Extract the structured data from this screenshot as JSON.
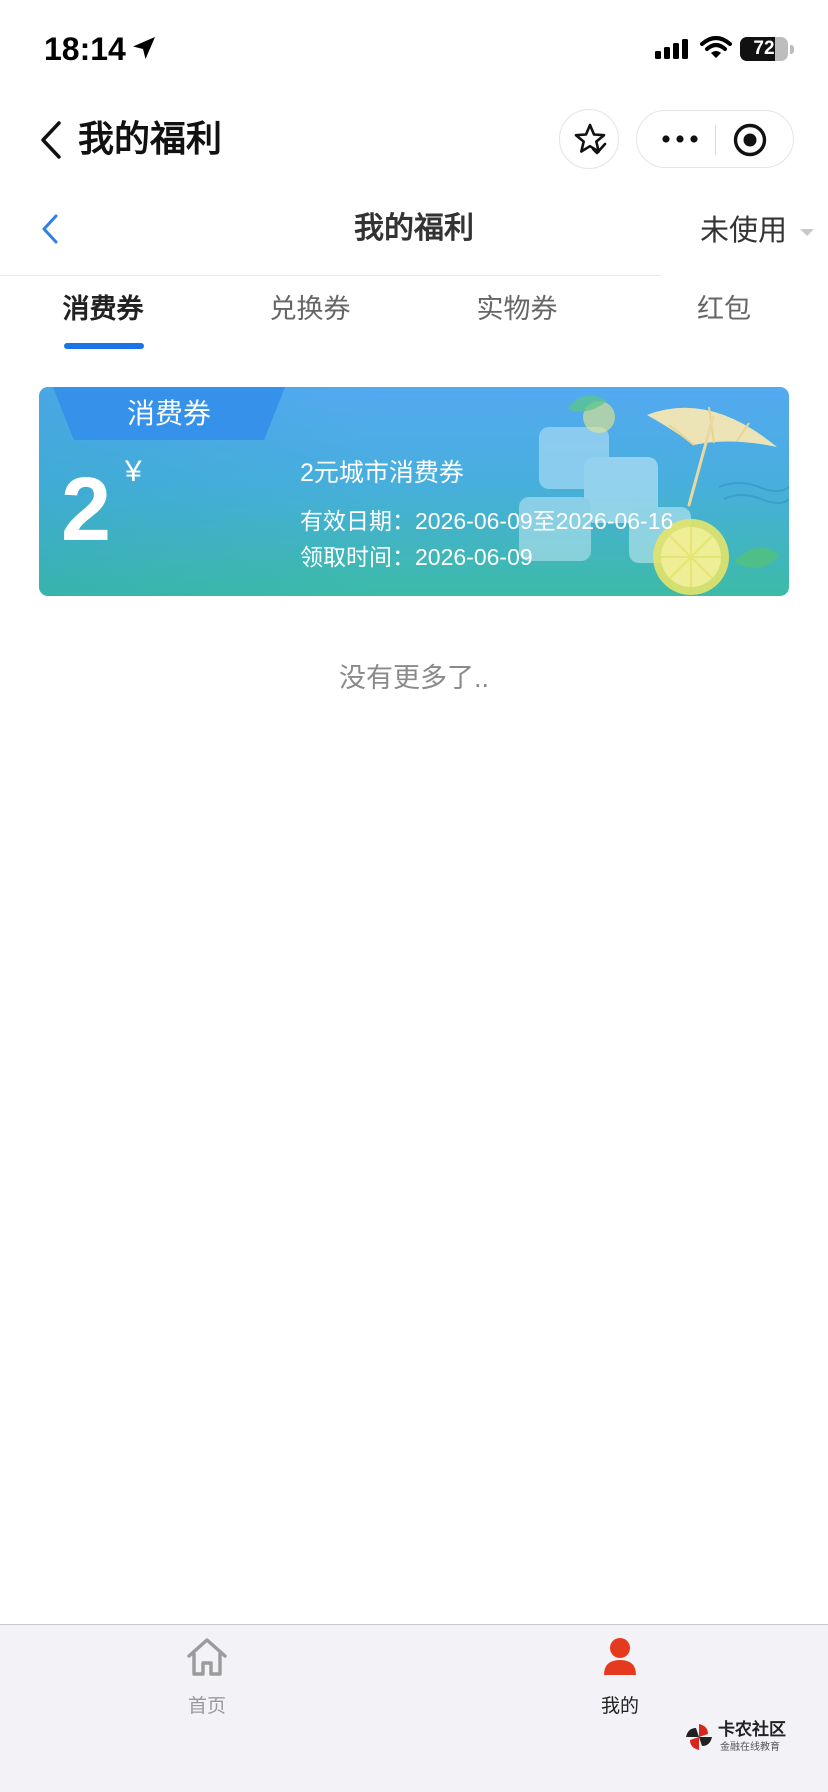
{
  "status_bar": {
    "time": "18:14",
    "battery": "72",
    "icons": [
      "location-arrow-icon",
      "signal-icon",
      "wifi-icon",
      "battery-icon"
    ]
  },
  "mini_header": {
    "title": "我的福利",
    "icons": [
      "back-chevron-icon",
      "star-check-icon",
      "more-dots-icon",
      "target-icon"
    ]
  },
  "page_header": {
    "title": "我的福利",
    "filter": "未使用"
  },
  "tabs": [
    {
      "label": "消费券",
      "active": true
    },
    {
      "label": "兑换券",
      "active": false
    },
    {
      "label": "实物券",
      "active": false
    },
    {
      "label": "红包",
      "active": false
    }
  ],
  "coupon": {
    "tag": "消费券",
    "amount": "2",
    "currency": "¥",
    "name": "2元城市消费券",
    "valid": "有效日期：2026-06-09至2026-06-16",
    "received": "领取时间：2026-06-09"
  },
  "list_end": "没有更多了..",
  "bottom_nav": [
    {
      "label": "首页",
      "icon": "home-icon",
      "active": false
    },
    {
      "label": "我的",
      "icon": "user-icon",
      "active": true
    }
  ],
  "watermark": {
    "name": "卡农社区",
    "tagline": "金融在线教育"
  },
  "colors": {
    "accent_blue": "#1a74e8",
    "back_chevron_blue": "#2f80e6",
    "card_top": "#54a9f1",
    "card_bottom": "#3cbba6",
    "tag_blue": "#3591ea",
    "nav_active_red": "#e63a1f",
    "nav_inactive_gray": "#9a9a9a"
  }
}
